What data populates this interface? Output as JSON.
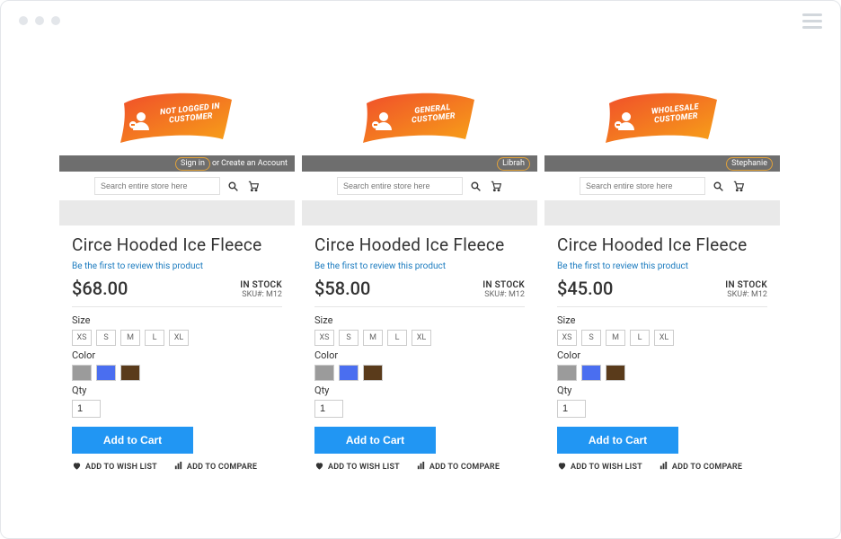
{
  "search_placeholder": "Search entire store here",
  "product": {
    "title": "Circe Hooded Ice Fleece",
    "review_prompt": "Be the first to review this product",
    "stock_label": "IN STOCK",
    "sku_label": "SKU#: M12",
    "size_label": "Size",
    "sizes": [
      "XS",
      "S",
      "M",
      "L",
      "XL"
    ],
    "color_label": "Color",
    "colors": [
      "#9b9b9b",
      "#4a6ef0",
      "#5a3b1b"
    ],
    "qty_label": "Qty",
    "qty_value": "1",
    "add_to_cart": "Add to Cart",
    "wish": "ADD TO WISH LIST",
    "compare": "ADD TO COMPARE"
  },
  "cards": [
    {
      "banner_lines": "Not Logged In\nCustomer",
      "account_left": "Sign in",
      "account_mid": " or ",
      "account_right": "Create an Account",
      "price": "$68.00",
      "pill_mode": "left"
    },
    {
      "banner_lines": "General\nCustomer",
      "account_name": "Librah",
      "price": "$58.00",
      "pill_mode": "name"
    },
    {
      "banner_lines": "Wholesale\nCustomer",
      "account_name": "Stephanie",
      "price": "$45.00",
      "pill_mode": "name"
    }
  ]
}
